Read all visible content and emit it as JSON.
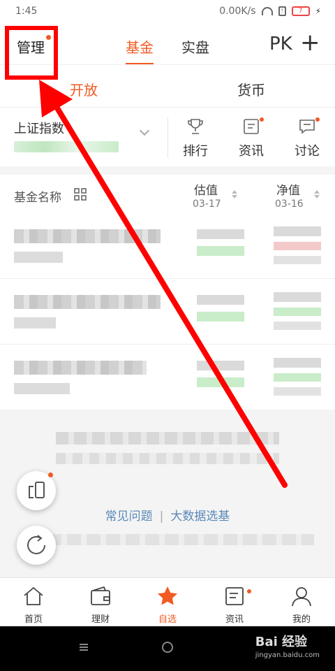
{
  "status": {
    "time": "1:45",
    "speed": "0.00K/s",
    "battery": "7"
  },
  "header": {
    "manage_label": "管理",
    "tabs": [
      "基金",
      "实盘"
    ],
    "pk_label": "PK",
    "add_label": "+"
  },
  "subtabs": [
    "开放",
    "货币"
  ],
  "index": {
    "name": "上证指数",
    "actions": [
      "排行",
      "资讯",
      "讨论"
    ]
  },
  "list": {
    "title": "基金名称",
    "columns": [
      {
        "label": "估值",
        "date": "03-17"
      },
      {
        "label": "净值",
        "date": "03-16"
      }
    ]
  },
  "footer_links": [
    "常见问题",
    "大数据选基"
  ],
  "tabbar": [
    "首页",
    "理财",
    "自选",
    "资讯",
    "我的"
  ],
  "watermark": {
    "brand": "Bai 经验",
    "url": "jingyan.baidu.com"
  },
  "colors": {
    "accent": "#f15a22",
    "annotation_red": "#ff0000",
    "link": "#5b89b8"
  }
}
